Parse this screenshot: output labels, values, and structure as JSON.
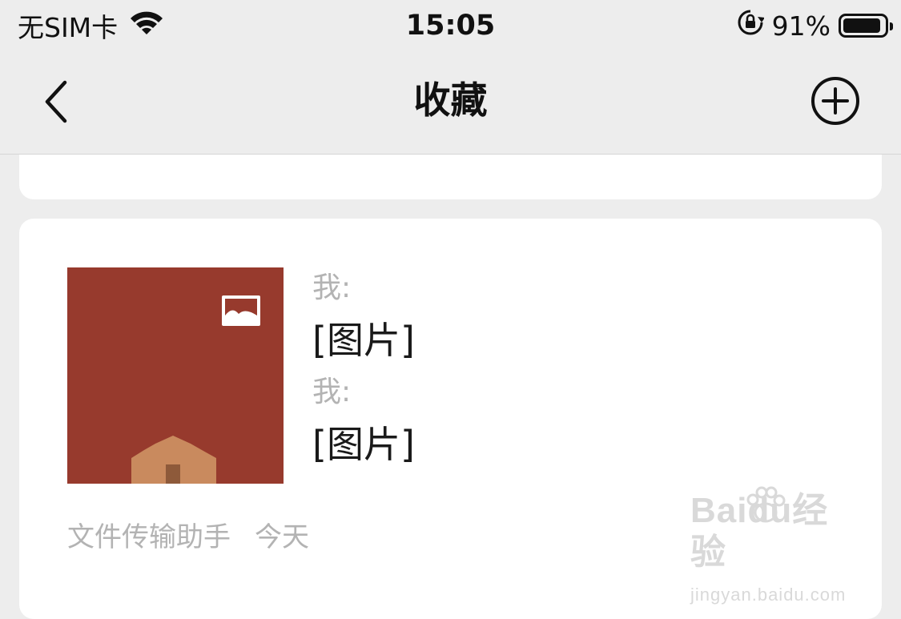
{
  "status_bar": {
    "carrier": "无SIM卡",
    "time": "15:05",
    "battery_percent": "91%",
    "battery_level": 0.91,
    "icons": [
      "wifi-icon",
      "orientation-lock-icon",
      "battery-icon"
    ]
  },
  "nav": {
    "title": "收藏",
    "back_icon": "chevron-left-icon",
    "add_icon": "plus-circle-icon"
  },
  "favorite_item": {
    "thumbnail_color": "#973a2d",
    "thumbnail_badge_icon": "image-icon",
    "lines": [
      {
        "sender": "我:",
        "message": "[图片]"
      },
      {
        "sender": "我:",
        "message": "[图片]"
      }
    ],
    "source": "文件传输助手",
    "date": "今天"
  },
  "watermark": {
    "brand": "Baidu经验",
    "url": "jingyan.baidu.com"
  }
}
